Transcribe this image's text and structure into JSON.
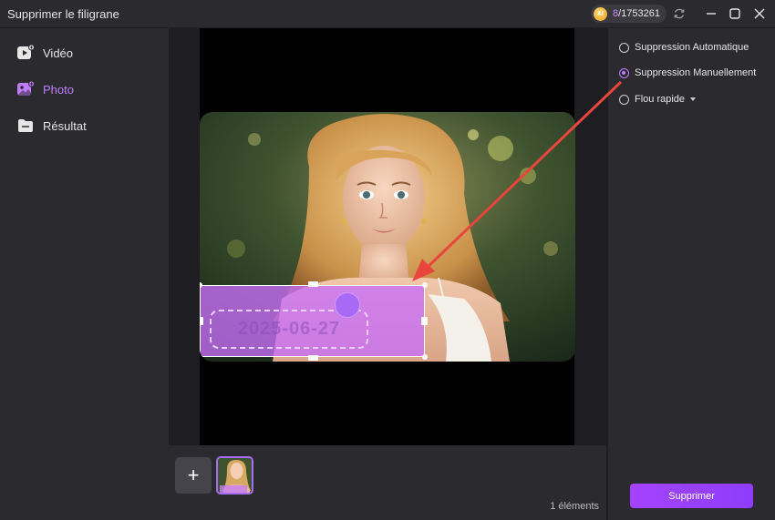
{
  "window": {
    "title": "Supprimer le filigrane",
    "credits_badge": "AI",
    "credits_used": "8",
    "credits_total": "/1753261"
  },
  "sidebar": {
    "items": [
      {
        "label": "Vidéo",
        "icon": "video-icon",
        "active": false
      },
      {
        "label": "Photo",
        "icon": "photo-icon",
        "active": true
      },
      {
        "label": "Résultat",
        "icon": "folder-icon",
        "active": false
      }
    ]
  },
  "canvas": {
    "watermark_text": "2025-06-27"
  },
  "thumbnails": {
    "add_label": "+",
    "count_label": "1 éléments"
  },
  "options": {
    "items": [
      {
        "label": "Suppression Automatique",
        "selected": false
      },
      {
        "label": "Suppression Manuellement",
        "selected": true
      },
      {
        "label": "Flou rapide",
        "selected": false,
        "has_dropdown": true
      }
    ],
    "delete_label": "Supprimer"
  },
  "colors": {
    "accent": "#c07bff",
    "button": "#9a40fd",
    "annotation_arrow": "#e8453c"
  }
}
